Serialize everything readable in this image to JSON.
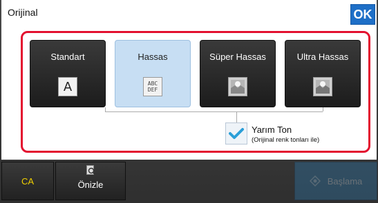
{
  "header": {
    "title": "Orijinal",
    "ok_label": "OK"
  },
  "resolution_options": [
    {
      "label": "Standart",
      "icon": "A",
      "selected": false
    },
    {
      "label": "Hassas",
      "icon": "ABC DEF",
      "selected": true
    },
    {
      "label": "Süper Hassas",
      "icon": "image-icon",
      "selected": false
    },
    {
      "label": "Ultra Hassas",
      "icon": "image-icon",
      "selected": false
    }
  ],
  "halftone": {
    "label": "Yarım Ton",
    "sublabel": "(Orijinal renk tonları ile)",
    "checked": true
  },
  "bottom_bar": {
    "ca_label": "CA",
    "preview_label": "Önizle",
    "start_label": "Başlama"
  },
  "colors": {
    "accent": "#1e6fc7",
    "highlight_frame": "#e3102f",
    "selected_bg": "#c7def3",
    "ca_text": "#f0d000"
  },
  "icons": {
    "abc_top": "ABC",
    "abc_bottom": "DEF"
  }
}
